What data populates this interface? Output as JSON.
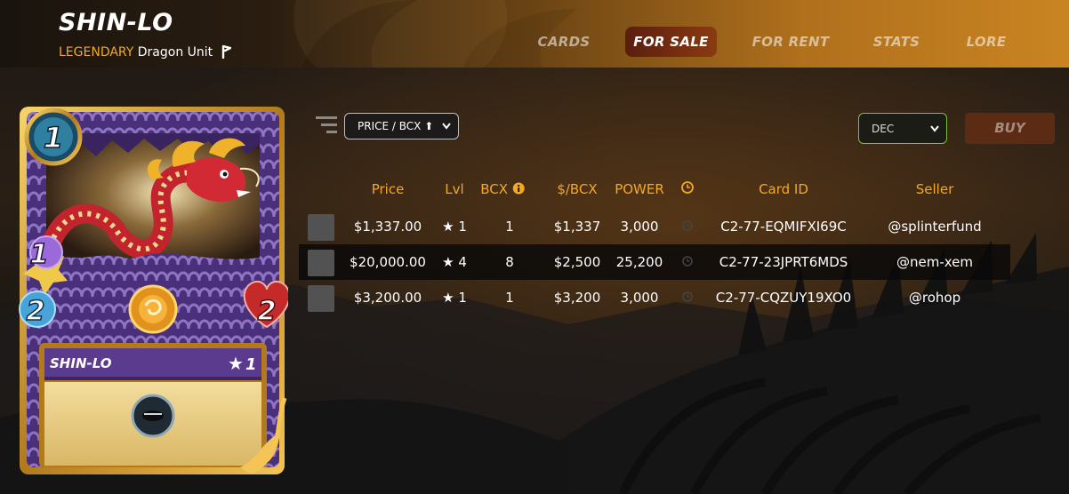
{
  "card": {
    "name": "SHIN-LO",
    "rarity": "LEGENDARY",
    "unit_type": "Dragon Unit",
    "card_title": "SHIN-LO",
    "card_level": "1",
    "mana": "1",
    "attack": "1",
    "speed": "2",
    "health": "2"
  },
  "nav": {
    "items": [
      {
        "label": "CARDS"
      },
      {
        "label": "FOR SALE"
      },
      {
        "label": "FOR RENT"
      },
      {
        "label": "STATS"
      },
      {
        "label": "LORE"
      }
    ],
    "active": "FOR SALE"
  },
  "controls": {
    "sort_value": "PRICE / BCX",
    "currency_value": "DEC",
    "buy_label": "BUY"
  },
  "table": {
    "headers": {
      "price": "Price",
      "lvl": "Lvl",
      "bcx": "BCX",
      "per_bcx": "$/BCX",
      "power": "POWER",
      "card_id": "Card ID",
      "seller": "Seller"
    },
    "rows": [
      {
        "price": "$1,337.00",
        "lvl": "1",
        "bcx": "1",
        "per_bcx": "$1,337",
        "power": "3,000",
        "card_id": "C2-77-EQMIFXI69C",
        "seller": "@splinterfund"
      },
      {
        "price": "$20,000.00",
        "lvl": "4",
        "bcx": "8",
        "per_bcx": "$2,500",
        "power": "25,200",
        "card_id": "C2-77-23JPRT6MDS",
        "seller": "@nem-xem"
      },
      {
        "price": "$3,200.00",
        "lvl": "1",
        "bcx": "1",
        "per_bcx": "$3,200",
        "power": "3,000",
        "card_id": "C2-77-CQZUY19XO0",
        "seller": "@rohop"
      }
    ]
  },
  "colors": {
    "accent_gold": "#f2a928",
    "active_tab": "#7a3012",
    "buy_button": "#5b2c13",
    "currency_border": "#7cbf3a"
  }
}
